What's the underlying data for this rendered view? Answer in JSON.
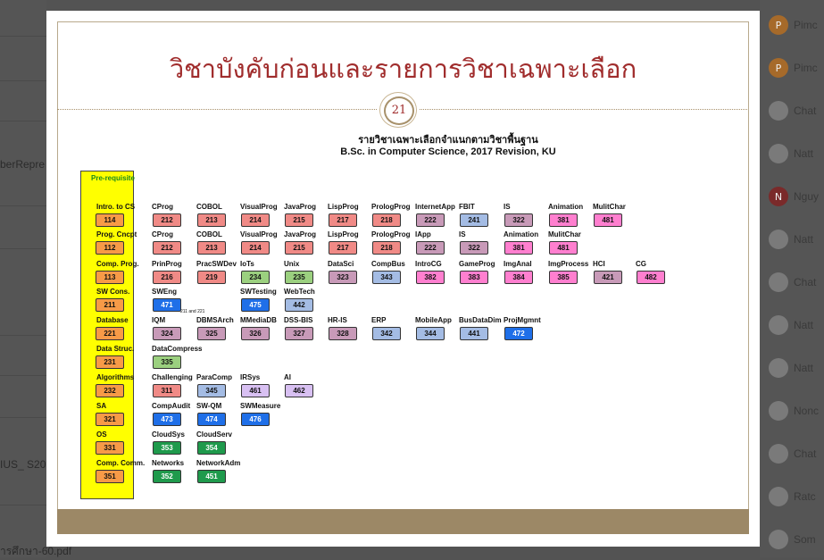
{
  "slide": {
    "title": "วิชาบังคับก่อนและรายการวิชาเฉพาะเลือก",
    "page_number": "21",
    "subtitle_line1": "รายวิชาเฉพาะเลือกจำแนกตามวิชาพื้นฐาน",
    "subtitle_line2": "B.Sc. in Computer Science, 2017 Revision, KU",
    "prereq_label": "Pre-requisite",
    "note_small": "211 and 221"
  },
  "colors": {
    "orange": "#f79a47",
    "salmon": "#f08a86",
    "mauve": "#c89ab8",
    "lightblue": "#a4bce4",
    "pink": "#ff7fcf",
    "green": "#9bd07f",
    "blue": "#1f6fe8",
    "lavender": "#d8c0f2",
    "darkgreen": "#1f9a4c"
  },
  "rows": [
    {
      "pre_name": "Intro. to CS",
      "pre_code": "114",
      "courses": [
        {
          "name": "CProg",
          "code": "212",
          "color": "salmon"
        },
        {
          "name": "COBOL",
          "code": "213",
          "color": "salmon"
        },
        {
          "name": "VisualProg",
          "code": "214",
          "color": "salmon"
        },
        {
          "name": "JavaProg",
          "code": "215",
          "color": "salmon"
        },
        {
          "name": "LispProg",
          "code": "217",
          "color": "salmon"
        },
        {
          "name": "PrologProg",
          "code": "218",
          "color": "salmon"
        },
        {
          "name": "InternetApp",
          "code": "222",
          "color": "mauve"
        },
        {
          "name": "FBIT",
          "code": "241",
          "color": "lightblue"
        },
        {
          "name": "IS",
          "code": "322",
          "color": "mauve"
        },
        {
          "name": "Animation",
          "code": "381",
          "color": "pink"
        },
        {
          "name": "MulitChar",
          "code": "481",
          "color": "pink"
        }
      ]
    },
    {
      "pre_name": "Prog. Cncpt",
      "pre_code": "112",
      "courses": [
        {
          "name": "CProg",
          "code": "212",
          "color": "salmon"
        },
        {
          "name": "COBOL",
          "code": "213",
          "color": "salmon"
        },
        {
          "name": "VisualProg",
          "code": "214",
          "color": "salmon"
        },
        {
          "name": "JavaProg",
          "code": "215",
          "color": "salmon"
        },
        {
          "name": "LispProg",
          "code": "217",
          "color": "salmon"
        },
        {
          "name": "PrologProg",
          "code": "218",
          "color": "salmon"
        },
        {
          "name": "IApp",
          "code": "222",
          "color": "mauve"
        },
        {
          "name": "IS",
          "code": "322",
          "color": "mauve"
        },
        {
          "name": "Animation",
          "code": "381",
          "color": "pink"
        },
        {
          "name": "MulitChar",
          "code": "481",
          "color": "pink"
        }
      ]
    },
    {
      "pre_name": "Comp. Prog.",
      "pre_code": "113",
      "courses": [
        {
          "name": "PrinProg",
          "code": "216",
          "color": "salmon"
        },
        {
          "name": "PracSWDev",
          "code": "219",
          "color": "salmon"
        },
        {
          "name": "IoTs",
          "code": "234",
          "color": "green"
        },
        {
          "name": "Unix",
          "code": "235",
          "color": "green"
        },
        {
          "name": "DataSci",
          "code": "323",
          "color": "mauve"
        },
        {
          "name": "CompBus",
          "code": "343",
          "color": "lightblue"
        },
        {
          "name": "IntroCG",
          "code": "382",
          "color": "pink"
        },
        {
          "name": "GameProg",
          "code": "383",
          "color": "pink"
        },
        {
          "name": "ImgAnal",
          "code": "384",
          "color": "pink"
        },
        {
          "name": "ImgProcess",
          "code": "385",
          "color": "pink"
        },
        {
          "name": "HCI",
          "code": "421",
          "color": "mauve"
        },
        {
          "name": "CG",
          "code": "482",
          "color": "pink"
        }
      ]
    },
    {
      "pre_name": "SW Cons.",
      "pre_code": "211",
      "courses": [
        {
          "name": "SWEng",
          "code": "471",
          "color": "blue"
        },
        {
          "name": "SWTesting",
          "code": "475",
          "color": "blue"
        },
        {
          "name": "WebTech",
          "code": "442",
          "color": "lightblue"
        }
      ]
    },
    {
      "pre_name": "Database",
      "pre_code": "221",
      "courses": [
        {
          "name": "IQM",
          "code": "324",
          "color": "mauve"
        },
        {
          "name": "DBMSArch",
          "code": "325",
          "color": "mauve"
        },
        {
          "name": "MMediaDB",
          "code": "326",
          "color": "mauve"
        },
        {
          "name": "DSS-BIS",
          "code": "327",
          "color": "mauve"
        },
        {
          "name": "HR-IS",
          "code": "328",
          "color": "mauve"
        },
        {
          "name": "ERP",
          "code": "342",
          "color": "lightblue"
        },
        {
          "name": "MobileApp",
          "code": "344",
          "color": "lightblue"
        },
        {
          "name": "BusDataDim",
          "code": "441",
          "color": "lightblue"
        },
        {
          "name": "ProjMgmnt",
          "code": "472",
          "color": "blue"
        }
      ]
    },
    {
      "pre_name": "Data Struc.",
      "pre_code": "231",
      "courses": [
        {
          "name": "DataCompress",
          "code": "335",
          "color": "green"
        }
      ]
    },
    {
      "pre_name": "Algorithms",
      "pre_code": "232",
      "courses": [
        {
          "name": "Challenging",
          "code": "311",
          "color": "salmon"
        },
        {
          "name": "ParaComp",
          "code": "345",
          "color": "lightblue"
        },
        {
          "name": "IRSys",
          "code": "461",
          "color": "lavender"
        },
        {
          "name": "AI",
          "code": "462",
          "color": "lavender"
        }
      ]
    },
    {
      "pre_name": "SA",
      "pre_code": "321",
      "courses": [
        {
          "name": "CompAudit",
          "code": "473",
          "color": "blue"
        },
        {
          "name": "SW-QM",
          "code": "474",
          "color": "blue"
        },
        {
          "name": "SWMeasure",
          "code": "476",
          "color": "blue"
        }
      ]
    },
    {
      "pre_name": "OS",
      "pre_code": "331",
      "courses": [
        {
          "name": "CloudSys",
          "code": "353",
          "color": "darkgreen"
        },
        {
          "name": "CloudServ",
          "code": "354",
          "color": "darkgreen"
        }
      ]
    },
    {
      "pre_name": "Comp. Comm.",
      "pre_code": "351",
      "courses": [
        {
          "name": "Networks",
          "code": "352",
          "color": "darkgreen"
        },
        {
          "name": "NetworkAdm",
          "code": "451",
          "color": "darkgreen"
        }
      ]
    }
  ],
  "background": {
    "left_texts": [
      "berRepre",
      "IUS_ S20",
      "ารศึกษา-60.pdf"
    ],
    "right_items": [
      {
        "initial": "P",
        "name": "Pimc"
      },
      {
        "initial": "P",
        "name": "Pimc"
      },
      {
        "initial": "",
        "name": "Chat"
      },
      {
        "initial": "",
        "name": "Natt"
      },
      {
        "initial": "N",
        "name": "Nguy"
      },
      {
        "initial": "",
        "name": "Natt"
      },
      {
        "initial": "",
        "name": "Chat"
      },
      {
        "initial": "",
        "name": "Natt"
      },
      {
        "initial": "",
        "name": "Natt"
      },
      {
        "initial": "",
        "name": "Nonc"
      },
      {
        "initial": "",
        "name": "Chat"
      },
      {
        "initial": "",
        "name": "Ratc"
      },
      {
        "initial": "",
        "name": "Som"
      }
    ]
  }
}
